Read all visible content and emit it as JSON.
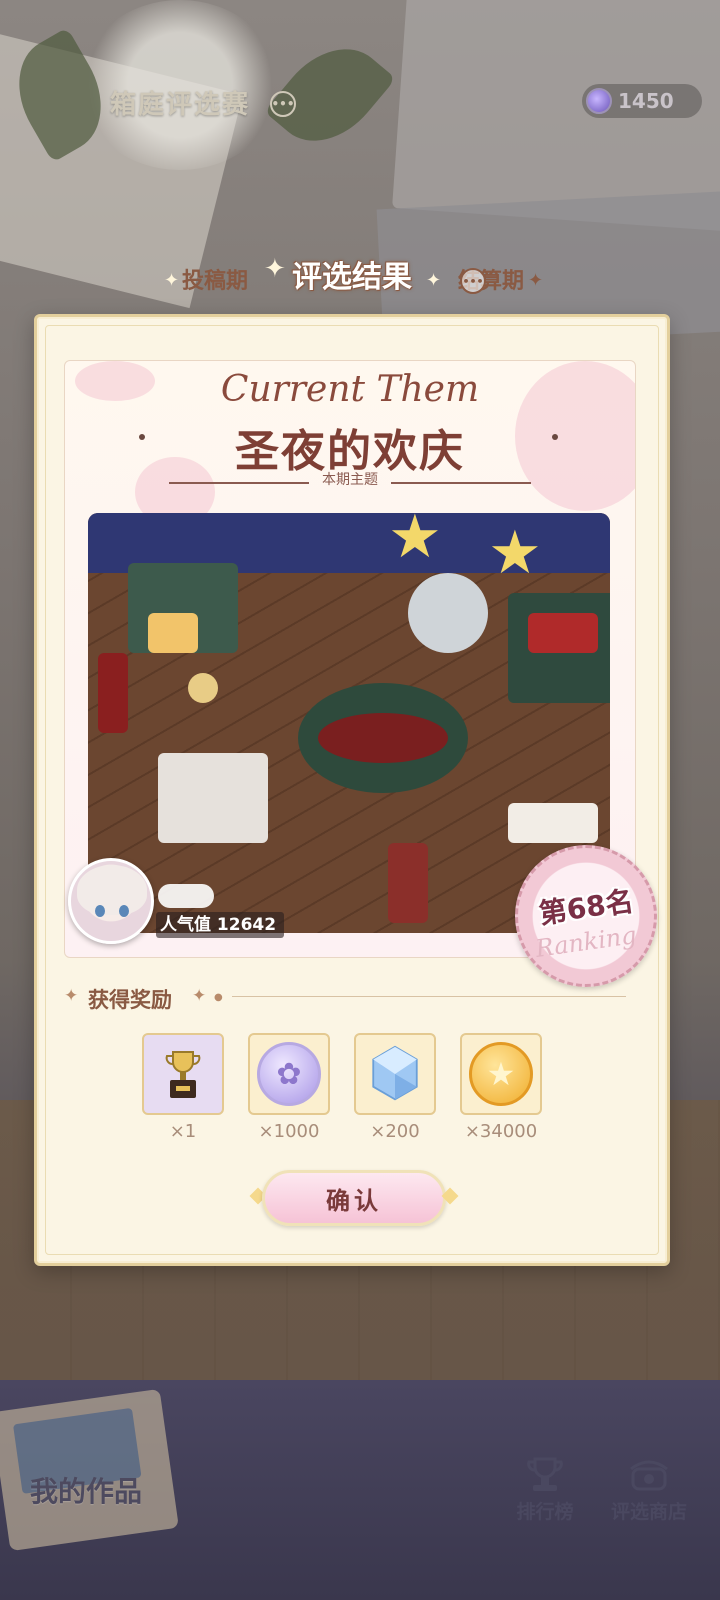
{
  "header": {
    "title": "箱庭评选赛",
    "more_icon": "chat-dots-icon",
    "currency": {
      "icon": "purple-gem-icon",
      "value": "1450"
    }
  },
  "stages": {
    "prev": "投稿期",
    "current": "评选结果",
    "next": "结算期"
  },
  "theme": {
    "script_title": "Current Them",
    "name": "圣夜的欢庆",
    "subtitle": "本期主题"
  },
  "entry": {
    "popularity_label": "人气值",
    "popularity_value": "12642",
    "rank_text": "第68名",
    "rank_sub": "Ranking"
  },
  "rewards": {
    "title": "获得奖励",
    "items": [
      {
        "icon": "trophy-icon",
        "count": "×1",
        "bg": "#e7dcf2"
      },
      {
        "icon": "flower-coin-icon",
        "count": "×1000",
        "bg": "#fbefcf"
      },
      {
        "icon": "crystal-icon",
        "count": "×200",
        "bg": "#fbefcf"
      },
      {
        "icon": "star-coin-icon",
        "count": "×34000",
        "bg": "#fbefcf"
      }
    ]
  },
  "confirm_label": "确认",
  "bottom_nav": {
    "my_works": "我的作品",
    "ranking": "排行榜",
    "shop": "评选商店"
  },
  "colors": {
    "accent_brown": "#8a5a43",
    "panel_bg": "#fbf5e4",
    "button_pink": "#f6c3d6"
  }
}
